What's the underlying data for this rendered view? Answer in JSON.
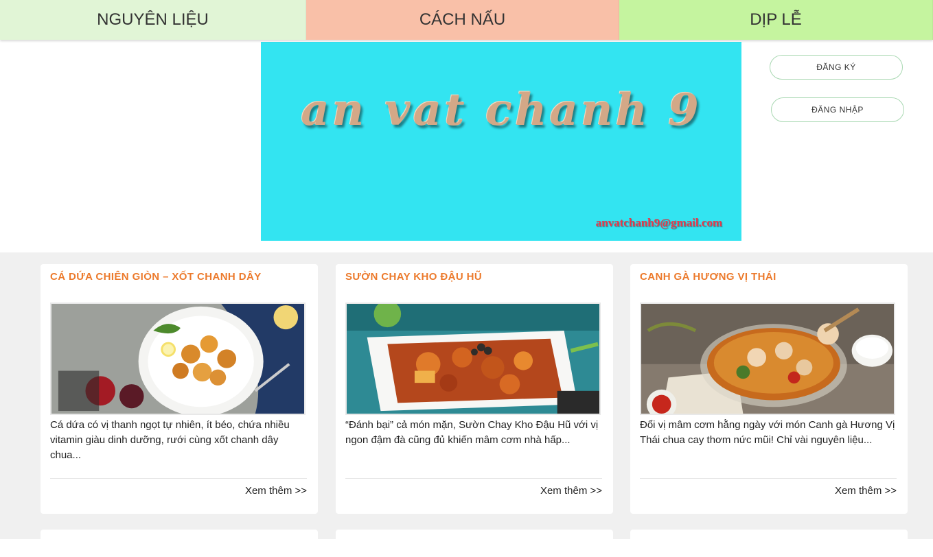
{
  "nav": {
    "tabs": [
      {
        "label": "NGUYÊN LIỆU"
      },
      {
        "label": "CÁCH NẤU"
      },
      {
        "label": "DỊP LỄ"
      }
    ]
  },
  "banner": {
    "title": "an vat chanh 9",
    "email": "anvatchanh9@gmail.com"
  },
  "auth": {
    "register_label": "ĐĂNG KÝ",
    "login_label": "ĐĂNG NHẬP"
  },
  "cards": [
    {
      "title": "CÁ DỨA CHIÊN GIÒN – XỐT CHANH DÂY",
      "description": "Cá dứa có vị thanh ngọt tự nhiên, ít béo, chứa nhiều vitamin giàu dinh dưỡng, rưới cùng xốt chanh dây chua...",
      "more": "Xem thêm >>"
    },
    {
      "title": "SƯỜN CHAY KHO ĐẬU HŨ",
      "description": "“Đánh bại” cả món mặn, Sườn Chay Kho Đậu Hũ với vị ngon đậm đà cũng đủ khiến mâm cơm nhà hấp...",
      "more": "Xem thêm >>"
    },
    {
      "title": "CANH GÀ HƯƠNG VỊ THÁI",
      "description": "Đổi vị mâm cơm hằng ngày với món Canh gà Hương Vị Thái chua cay thơm nức mũi! Chỉ vài nguyên liệu...",
      "more": "Xem thêm >>"
    }
  ],
  "colors": {
    "banner_bg": "#33e4f1",
    "card_title": "#ec7a2c",
    "tab1": "#e1f5d6",
    "tab2": "#f9c0a8",
    "tab3": "#c5f49f"
  }
}
